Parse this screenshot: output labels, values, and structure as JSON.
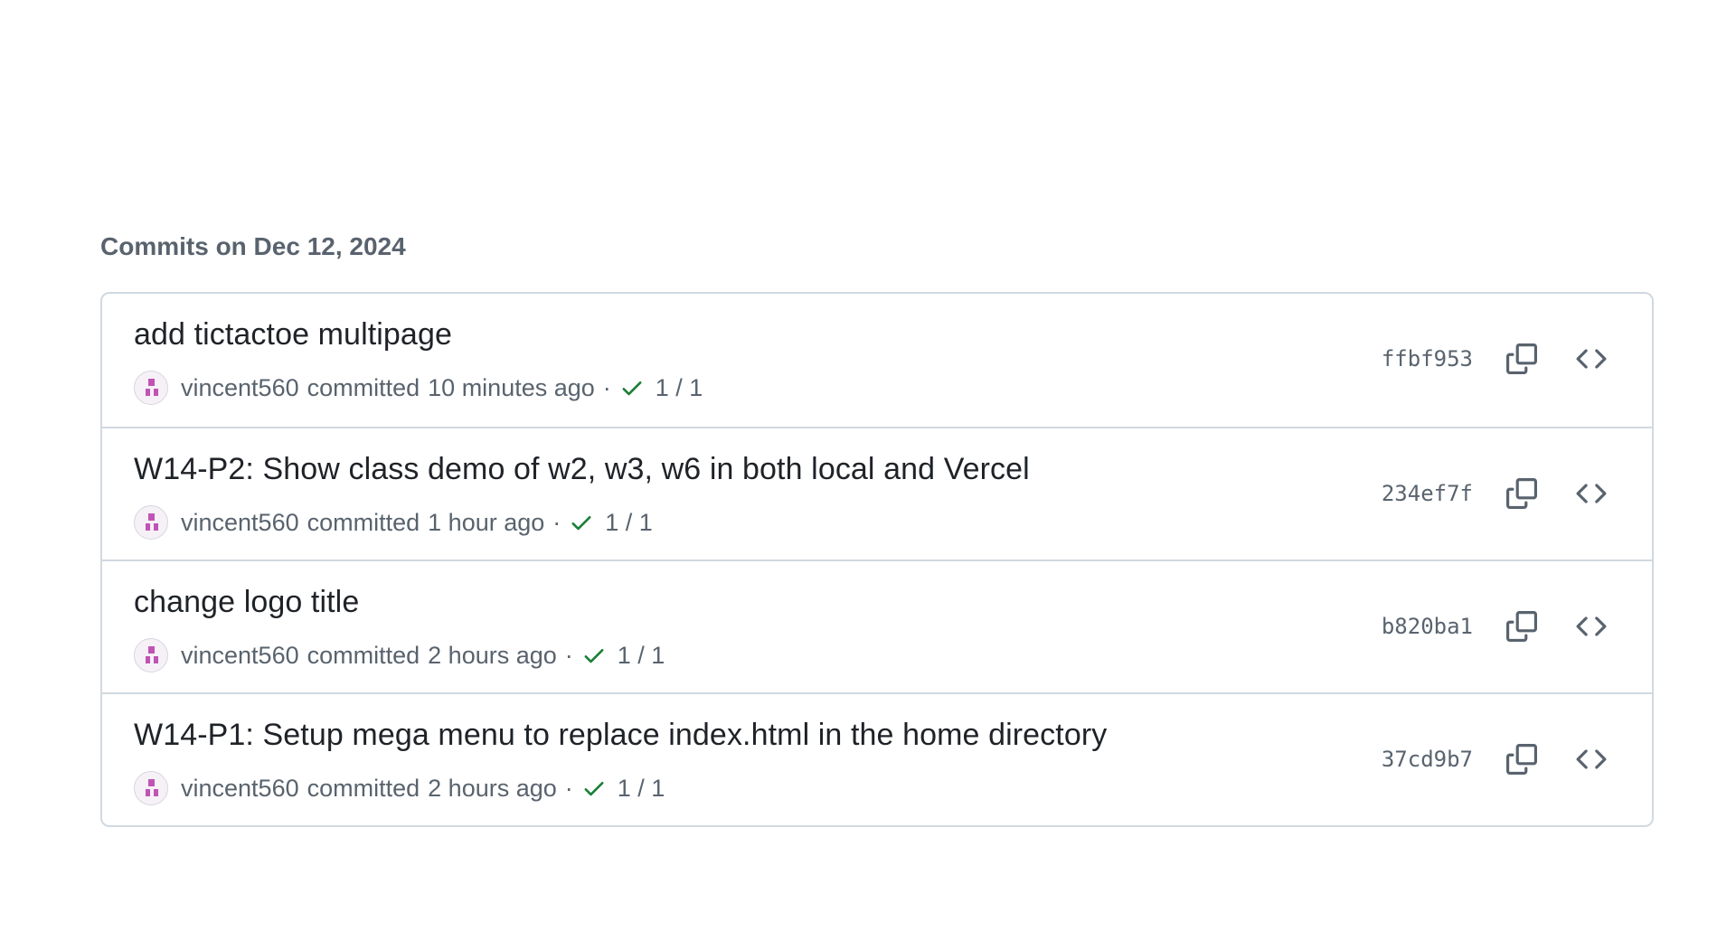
{
  "group": {
    "title": "Commits on Dec 12, 2024"
  },
  "commits": [
    {
      "title": "add tictactoe multipage",
      "author": "vincent560",
      "verb": "committed",
      "time": "10 minutes ago",
      "separator": "·",
      "checks": "1 / 1",
      "sha": "ffbf953"
    },
    {
      "title": "W14-P2: Show class demo of w2, w3, w6 in both local and Vercel",
      "author": "vincent560",
      "verb": "committed",
      "time": "1 hour ago",
      "separator": "·",
      "checks": "1 / 1",
      "sha": "234ef7f"
    },
    {
      "title": "change logo title",
      "author": "vincent560",
      "verb": "committed",
      "time": "2 hours ago",
      "separator": "·",
      "checks": "1 / 1",
      "sha": "b820ba1"
    },
    {
      "title": "W14-P1: Setup mega menu to replace index.html in the home directory",
      "author": "vincent560",
      "verb": "committed",
      "time": "2 hours ago",
      "separator": "·",
      "checks": "1 / 1",
      "sha": "37cd9b7"
    }
  ],
  "icons": {
    "status": "check-icon",
    "copy": "copy-icon",
    "browse": "code-icon"
  },
  "colors": {
    "check": "#1a7f37",
    "avatar": "#c054b6",
    "border": "#d1d9e0",
    "muted": "#59636e"
  }
}
